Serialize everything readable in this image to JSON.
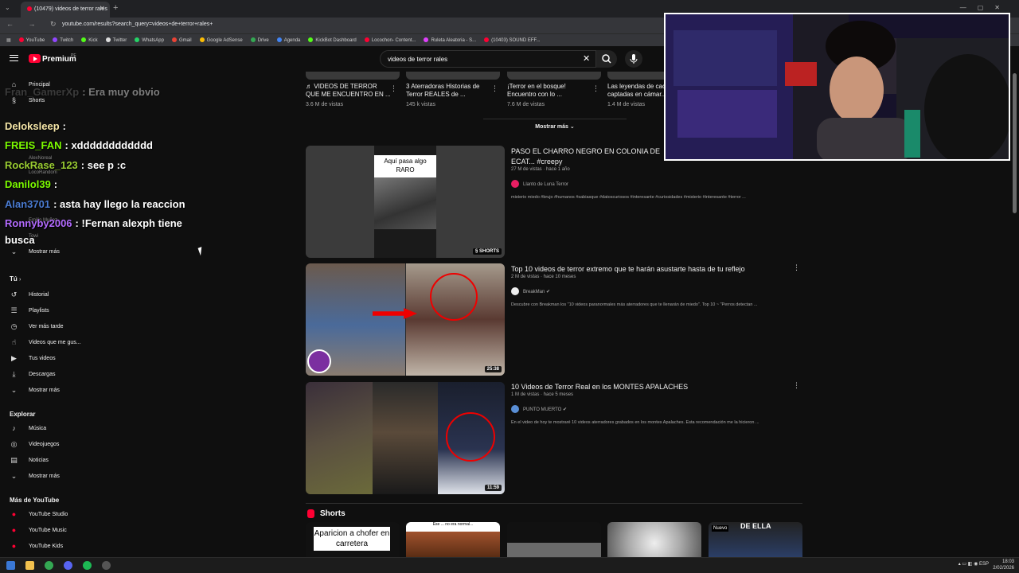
{
  "browser": {
    "tab_title": "(10479) videos de terror rales",
    "url": "youtube.com/results?search_query=videos+de+terror+rales+",
    "bookmarks": [
      {
        "label": "YouTube",
        "color": "#ff0033"
      },
      {
        "label": "Twitch",
        "color": "#9146ff"
      },
      {
        "label": "Kick",
        "color": "#53fc18"
      },
      {
        "label": "Twitter",
        "color": "#dddddd"
      },
      {
        "label": "WhatsApp",
        "color": "#25d366"
      },
      {
        "label": "Gmail",
        "color": "#ea4335"
      },
      {
        "label": "Google AdSense",
        "color": "#fbbc04"
      },
      {
        "label": "Drive",
        "color": "#34a853"
      },
      {
        "label": "Agenda",
        "color": "#4285f4"
      },
      {
        "label": "KickBot Dashboard",
        "color": "#53fc18"
      },
      {
        "label": "Locochon- Content...",
        "color": "#ff0033"
      },
      {
        "label": "Ruleta Aleatoria - S...",
        "color": "#e040fb"
      },
      {
        "label": "(10403) SOUND EFF...",
        "color": "#ff0033"
      }
    ]
  },
  "header": {
    "brand": "Premium",
    "country": "PE",
    "search_value": "videos de terror rales"
  },
  "sidebar": {
    "top": [
      {
        "label": "Principal",
        "icon": "home-icon",
        "glyph": "⌂"
      },
      {
        "label": "Shorts",
        "icon": "shorts-icon",
        "glyph": "§"
      }
    ],
    "subs_ghost": [
      "AlexNoreal",
      "LocoRandom",
      "Emilio Muñoz",
      "Towi"
    ],
    "subs_more": "Mostrar más",
    "you_heading": "Tú",
    "you": [
      {
        "label": "Historial",
        "icon": "history-icon",
        "glyph": "↺"
      },
      {
        "label": "Playlists",
        "icon": "playlists-icon",
        "glyph": "☰"
      },
      {
        "label": "Ver más tarde",
        "icon": "watch-later-icon",
        "glyph": "◷"
      },
      {
        "label": "Videos que me gus...",
        "icon": "like-icon",
        "glyph": "👍"
      },
      {
        "label": "Tus videos",
        "icon": "your-videos-icon",
        "glyph": "▶"
      },
      {
        "label": "Descargas",
        "icon": "download-icon",
        "glyph": "⤓"
      }
    ],
    "you_more": "Mostrar más",
    "explore_heading": "Explorar",
    "explore": [
      {
        "label": "Música",
        "icon": "music-icon",
        "glyph": "♪"
      },
      {
        "label": "Videojuegos",
        "icon": "gaming-icon",
        "glyph": "◎"
      },
      {
        "label": "Noticias",
        "icon": "news-icon",
        "glyph": "▤"
      }
    ],
    "explore_more": "Mostrar más",
    "more_heading": "Más de YouTube",
    "more": [
      {
        "label": "YouTube Studio",
        "icon": "youtube-studio-icon"
      },
      {
        "label": "YouTube Music",
        "icon": "youtube-music-icon"
      },
      {
        "label": "YouTube Kids",
        "icon": "youtube-kids-icon"
      }
    ]
  },
  "chat": [
    {
      "user": "Fran_GamerXp",
      "color": "#6f6f6f",
      "msg": ": Era muy obvio",
      "dim": true
    },
    {
      "user": "Deloksleep",
      "color": "#f5e6a8",
      "msg": ":"
    },
    {
      "user": "FREIS_FAN",
      "color": "#7cfc00",
      "msg": ": xdddddddddddd"
    },
    {
      "user": "RockRase_123",
      "color": "#9acd32",
      "msg": ": see p :c"
    },
    {
      "user": "Danilol39",
      "color": "#7cfc00",
      "msg": ":"
    },
    {
      "user": "Alan3701",
      "color": "#4a7bd1",
      "msg": ": asta hay llego la reaccion"
    },
    {
      "user": "Ronnyby2006",
      "color": "#b36bff",
      "msg": ": !Fernan alexph tiene"
    },
    {
      "user": "",
      "color": "#fff",
      "msg": "busca"
    }
  ],
  "top_row": [
    {
      "title": "VIDEOS DE TERROR QUE ME ENCUENTRO EN ...",
      "views": "3.6 M de vistas"
    },
    {
      "title": "3 Aterradoras Historias de Terror REALES de ...",
      "views": "145 k vistas"
    },
    {
      "title": "¡Terror en el bosque! Encuentro con lo ...",
      "views": "7.6 M de vistas"
    },
    {
      "title": "Las leyendas de cac... captadas en cámar...",
      "views": "1.4 M de vistas"
    }
  ],
  "show_more": "Mostrar más",
  "videos": [
    {
      "title": "PASO EL CHARRO NEGRO EN COLONIA DE ECAT... #creepy",
      "meta": "27 M de vistas · hace 1 año",
      "channel": "Llanto de Luna Terror",
      "avatar_color": "#e91e63",
      "desc": "misterio miedo #brujo #humanos #sabiasque #datoscuriosos #interesante #curiosidades #misterio #interesante #terror ...",
      "badge": "SHORTS",
      "overlay_text": "Aquí pasa algo RARO"
    },
    {
      "title": "Top 10 videos de terror extremo que te harán asustarte hasta de tu reflejo",
      "meta": "2 M de vistas · hace 10 meses",
      "channel": "BreakMan",
      "avatar_color": "#eeeeee",
      "desc": "Descubre con Breakman los \"10 videos paranormales más aterradores que te llenarán de miedo\". Top 10 ~ \"Perros detectan ...",
      "badge": "25:38"
    },
    {
      "title": "10 Videos de Terror Real en los MONTES APALACHES",
      "meta": "1 M de vistas · hace 5 meses",
      "channel": "PUNTO MUERTO",
      "avatar_color": "#5a8fd6",
      "desc": "En el video de hoy te mostraré 10 videos aterradores grabados en los montes Apalaches. Esta recomendación me la hicieron ...",
      "badge": "11:59"
    }
  ],
  "shorts": {
    "heading": "Shorts",
    "cards": [
      {
        "label": "Aparicion a chofer en carretera"
      },
      {
        "label": "Ese ... no era normal..."
      },
      {
        "label": ""
      },
      {
        "label": ""
      },
      {
        "label": "Nuevo",
        "label2": "DE ELLA"
      }
    ]
  },
  "taskbar": {
    "lang": "ESP",
    "time": "18:03",
    "date": "2/02/2026"
  }
}
